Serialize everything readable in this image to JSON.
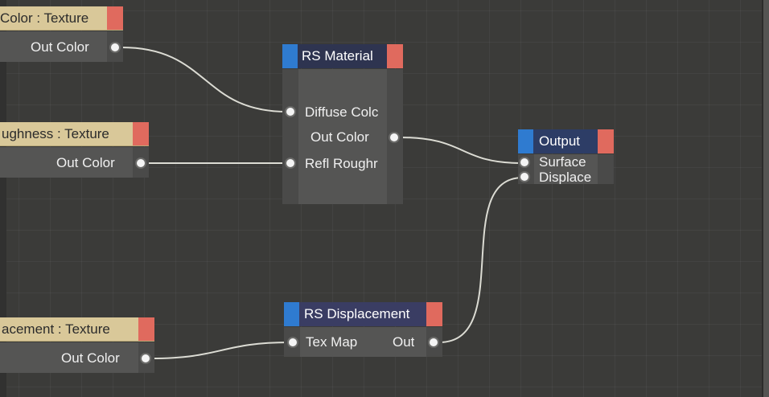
{
  "colors": {
    "background": "#3b3b39",
    "texture_header": "#d9c899",
    "node_header": "#2d3d66",
    "header_blue_tab": "#2f7bd0",
    "header_red_tab": "#e06a5e",
    "node_body": "#555554",
    "wire": "#dcdcd4"
  },
  "nodes": {
    "color_texture": {
      "title": "Color : Texture",
      "out": "Out Color"
    },
    "roughness_texture": {
      "title": "ughness : Texture",
      "out": "Out Color"
    },
    "displacement_texture": {
      "title": "acement : Texture",
      "out": "Out Color"
    },
    "rs_material": {
      "title": "RS Material",
      "in_diffuse": "Diffuse Colc",
      "out": "Out Color",
      "in_refl": "Refl Roughr"
    },
    "output": {
      "title": "Output",
      "in_surface": "Surface",
      "in_displace": "Displace"
    },
    "rs_displacement": {
      "title": "RS Displacement",
      "in_texmap": "Tex Map",
      "out": "Out"
    }
  }
}
